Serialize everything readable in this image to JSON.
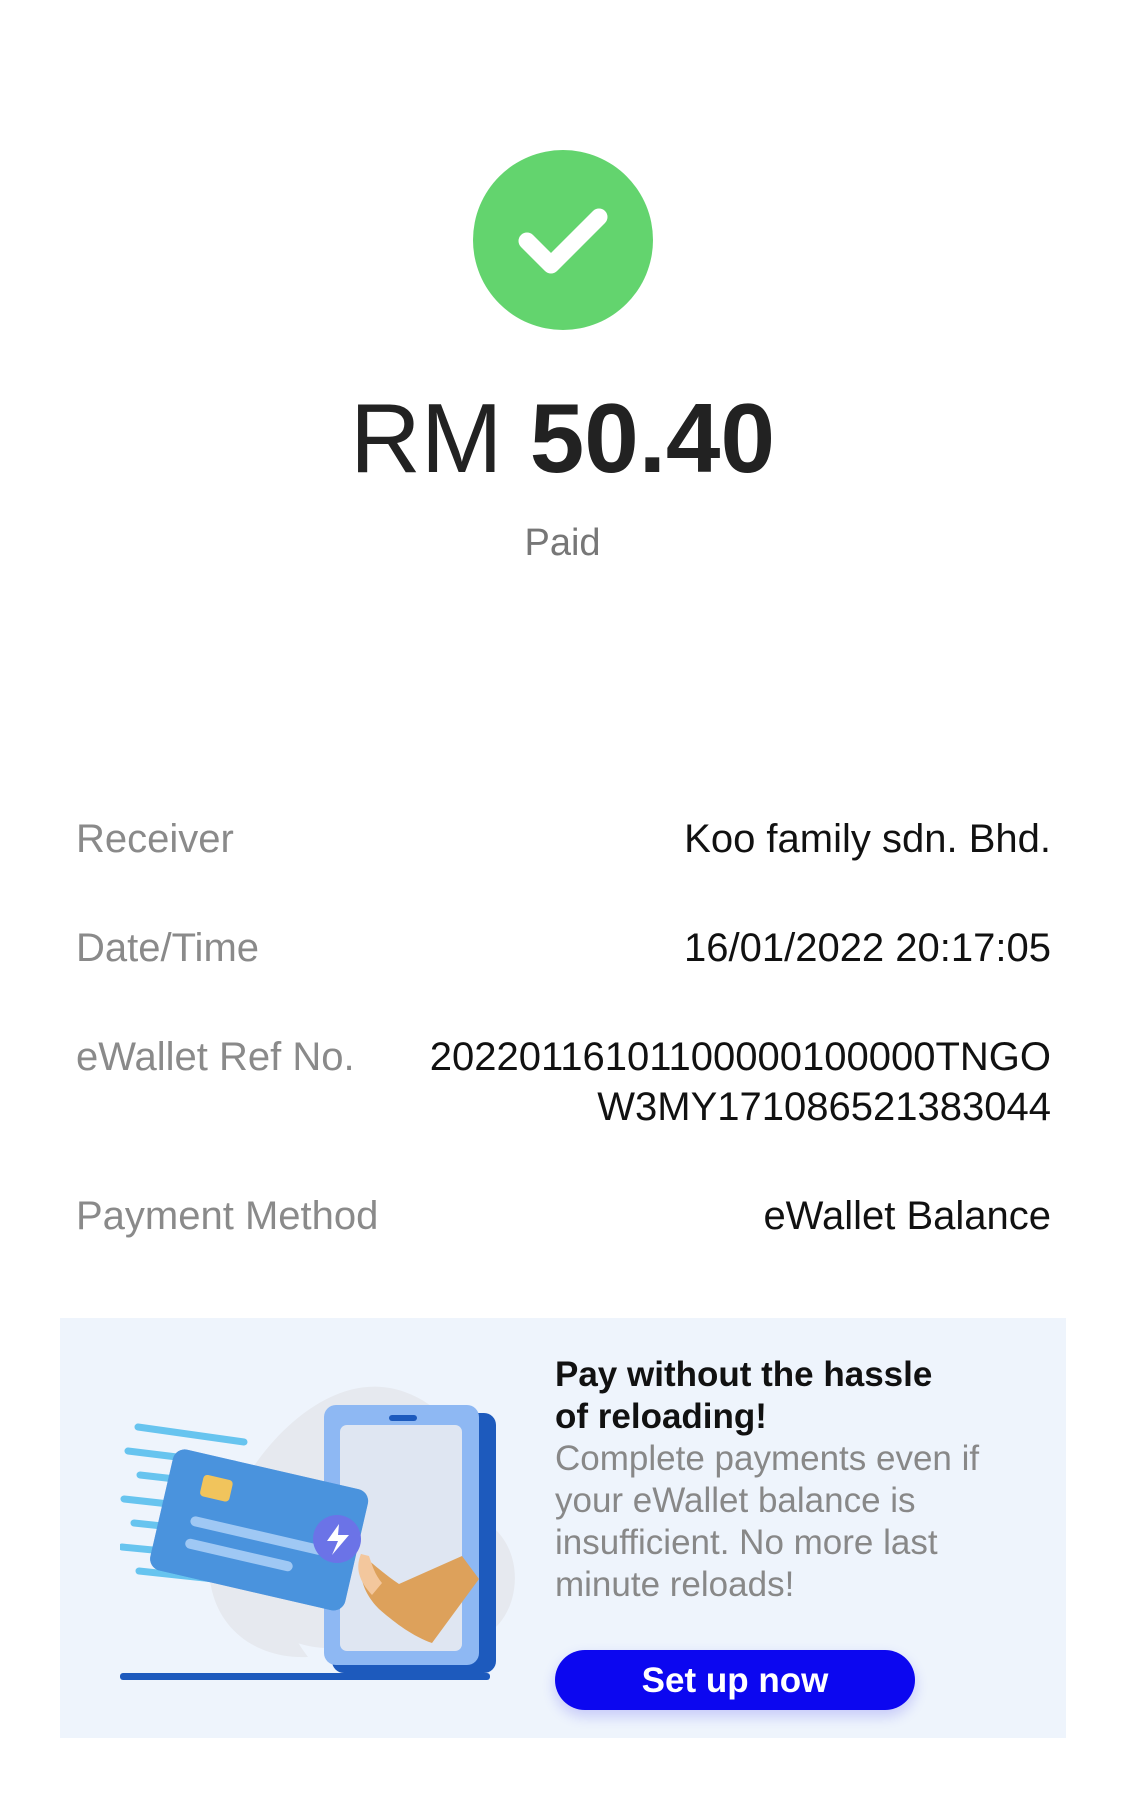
{
  "payment": {
    "currency": "RM",
    "amount": "50.40",
    "status": "Paid",
    "status_icon": "checkmark-icon",
    "status_color": "#63d46e"
  },
  "details": {
    "receiver": {
      "label": "Receiver",
      "value": "Koo family sdn. Bhd."
    },
    "datetime": {
      "label": "Date/Time",
      "value": "16/01/2022 20:17:05"
    },
    "ref": {
      "label": "eWallet Ref No.",
      "value": "20220116101100000100000TNGOW3MY171086521383044"
    },
    "method": {
      "label": "Payment Method",
      "value": "eWallet Balance"
    }
  },
  "promo": {
    "title": "Pay without the hassle of reloading!",
    "description": "Complete payments even if your eWallet balance is insufficient. No more last minute reloads!",
    "button_label": "Set up now",
    "button_color": "#0c07f0",
    "illustration": "card-phone-illustration"
  }
}
